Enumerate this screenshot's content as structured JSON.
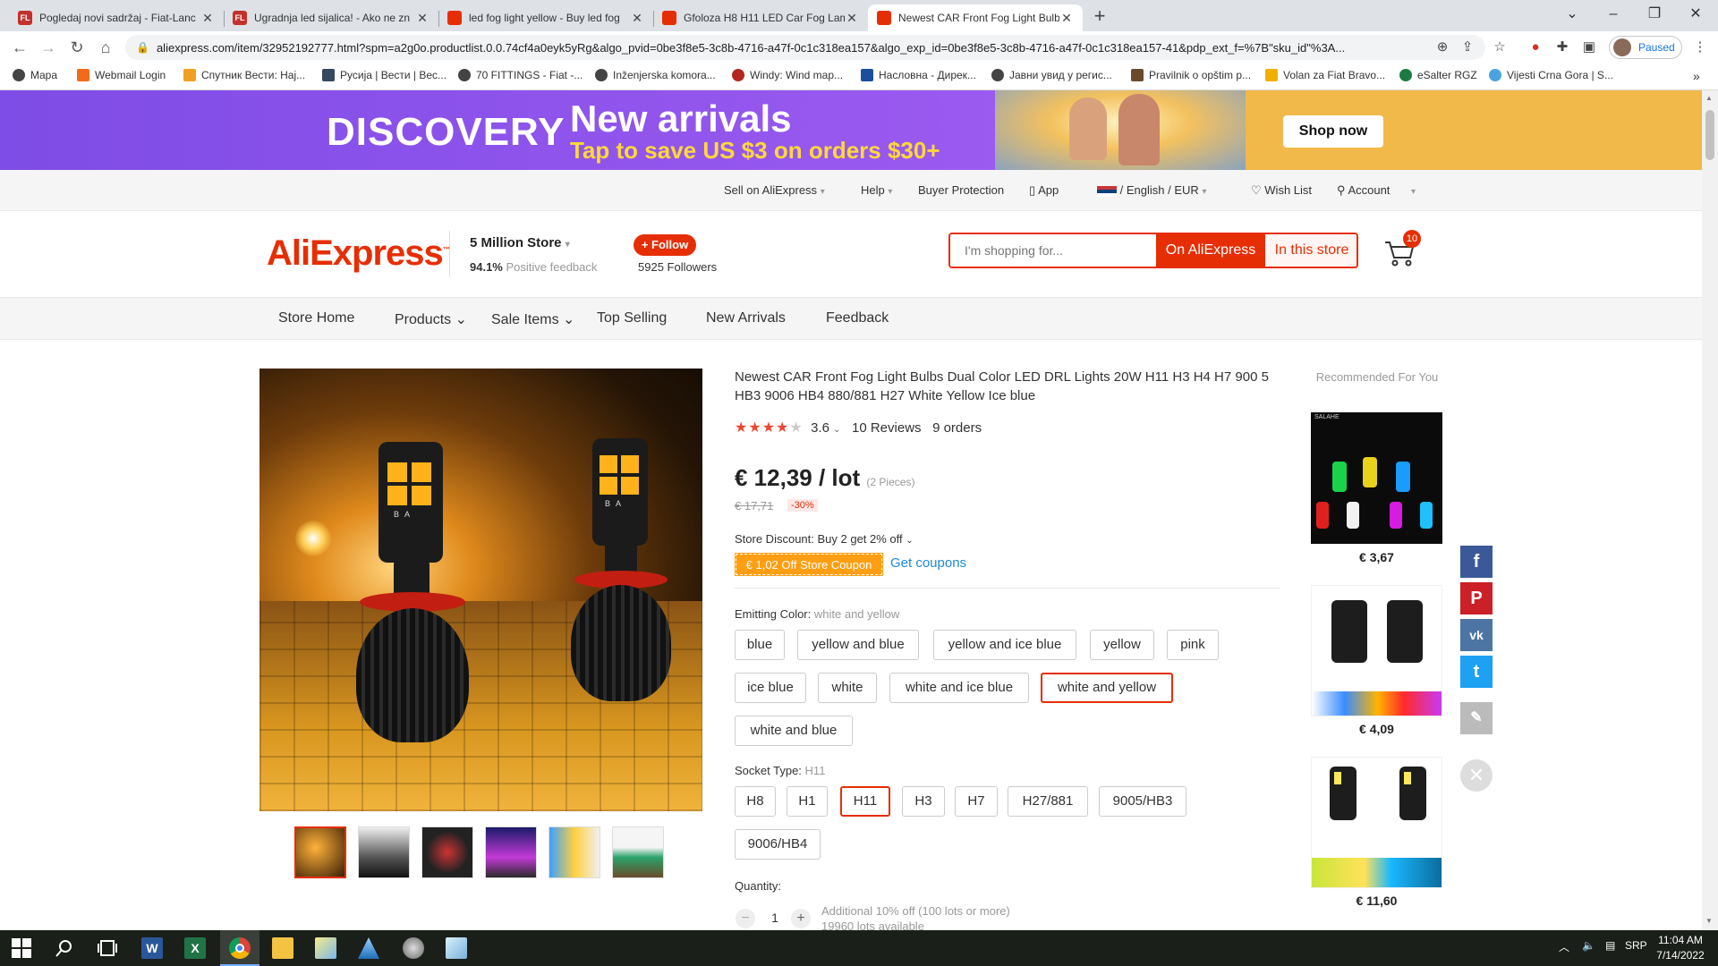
{
  "browser": {
    "tabs": [
      {
        "title": "Pogledaj novi sadržaj - Fiat-Lanc",
        "favicon": "forum-icon",
        "active": false
      },
      {
        "title": "Ugradnja led sijalica! - Ako ne zn",
        "favicon": "forum-icon",
        "active": false
      },
      {
        "title": "led fog light yellow - Buy led fog",
        "favicon": "aliexpress-icon",
        "active": false
      },
      {
        "title": "Gfoloza H8 H11 LED Car Fog Lam",
        "favicon": "aliexpress-icon",
        "active": false
      },
      {
        "title": "Newest CAR Front Fog Light Bulb",
        "favicon": "aliexpress-icon",
        "active": true
      }
    ],
    "url": "aliexpress.com/item/32952192777.html?spm=a2g0o.productlist.0.0.74cf4a0eyk5yRg&algo_pvid=0be3f8e5-3c8b-4716-a47f-0c1c318ea157&algo_exp_id=0be3f8e5-3c8b-4716-a47f-0c1c318ea157-41&pdp_ext_f=%7B\"sku_id\"%3A...",
    "profile_status": "Paused",
    "bookmarks": [
      "Mapa",
      "Webmail Login",
      "Спутник Вести: Нај...",
      "Русија | Вести | Вес...",
      "70 FITTINGS - Fiat -...",
      "Inženjerska komora...",
      "Windy: Wind map...",
      "Насловна - Дирек...",
      "Јавни увид у регис...",
      "Pravilnik o opštim p...",
      "Volan za Fiat Bravo...",
      "eSalter RGZ",
      "Vijesti Crna Gora | S..."
    ]
  },
  "banner": {
    "brand": "DISCOVERY",
    "headline": "New arrivals",
    "subline": "Tap to save US $3 on orders $30+",
    "cta": "Shop now"
  },
  "toplinks": {
    "sell": "Sell on AliExpress",
    "help": "Help",
    "buyer_protection": "Buyer Protection",
    "app": "App",
    "lang": "/ English /",
    "currency": "EUR",
    "wishlist": "Wish List",
    "account": "Account"
  },
  "store": {
    "logo": "AliExpress",
    "name": "5 Million Store",
    "feedback_pct": "94.1%",
    "feedback_label": "Positive feedback",
    "follow": "+ Follow",
    "followers": "5925 Followers",
    "search_placeholder": "I'm shopping for...",
    "on_aliexpress": "On AliExpress",
    "in_store": "In this store",
    "cart_count": "10"
  },
  "storenav": [
    "Store Home",
    "Products",
    "Sale Items",
    "Top Selling",
    "New Arrivals",
    "Feedback"
  ],
  "product": {
    "title": "Newest CAR Front Fog Light Bulbs Dual Color LED DRL Lights 20W H11 H3 H4 H7 900 5 HB3 9006 HB4 880/881 H27 White Yellow Ice blue",
    "rating": "3.6",
    "rating_value": 3.6,
    "reviews": "10 Reviews",
    "orders": "9 orders",
    "price": "€ 12,39 / lot",
    "pieces": "(2 Pieces)",
    "old_price": "€ 17,71",
    "discount": "-30%",
    "store_discount": "Store Discount: Buy 2 get 2% off",
    "coupon": "€ 1,02 Off Store Coupon",
    "get_coupons": "Get coupons",
    "color_label": "Emitting Color:",
    "color_selected": "white and yellow",
    "colors": [
      "blue",
      "yellow and blue",
      "yellow and ice blue",
      "yellow",
      "pink",
      "ice blue",
      "white",
      "white and ice blue",
      "white and yellow",
      "white and blue"
    ],
    "socket_label": "Socket Type:",
    "socket_selected": "H11",
    "sockets": [
      "H8",
      "H1",
      "H11",
      "H3",
      "H7",
      "H27/881",
      "9005/HB3",
      "9006/HB4"
    ],
    "quantity_label": "Quantity:",
    "quantity": "1",
    "additional": "Additional 10% off (100 lots or more)",
    "available": "19960 lots available",
    "bulb_markings": [
      "B",
      "A"
    ]
  },
  "recommended": {
    "header": "Recommended For You",
    "items": [
      {
        "price": "€ 3,67",
        "brand": "SALAHE"
      },
      {
        "price": "€ 4,09"
      },
      {
        "price": "€ 11,60"
      }
    ]
  },
  "taskbar": {
    "lang": "SRP",
    "time": "11:04 AM",
    "date": "7/14/2022"
  },
  "colors": {
    "accent": "#e62e04",
    "banner_purple": "#8a52ea",
    "banner_orange": "#f0b94a",
    "star": "#f04633",
    "coupon": "#ff9e12",
    "link": "#1a8cd8"
  }
}
